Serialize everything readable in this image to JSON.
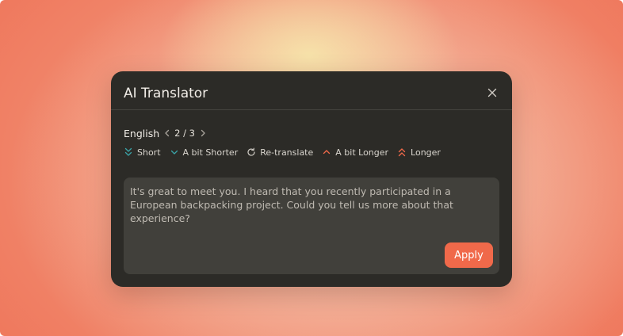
{
  "dialog": {
    "title": "AI Translator",
    "close_icon": "close-icon"
  },
  "language": {
    "name": "English",
    "prev_icon": "chevron-left-icon",
    "pager": "2 / 3",
    "next_icon": "chevron-right-icon"
  },
  "options": [
    {
      "label": "Short",
      "icon": "double-chevron-down-icon",
      "color": "#3aa3a6"
    },
    {
      "label": "A bit Shorter",
      "icon": "chevron-down-icon",
      "color": "#3aa3a6"
    },
    {
      "label": "Re-translate",
      "icon": "refresh-icon",
      "color": "#cfcbc4"
    },
    {
      "label": "A bit Longer",
      "icon": "chevron-up-icon",
      "color": "#f0694a"
    },
    {
      "label": "Longer",
      "icon": "double-chevron-up-icon",
      "color": "#f0694a"
    }
  ],
  "translation": {
    "text": "It's great to meet you. I heard that you recently participated in a European backpacking project. Could you tell us more about that experience?"
  },
  "apply_label": "Apply",
  "colors": {
    "background": "#ee6d52",
    "dialog": "#2c2b27",
    "text_area": "#41403b",
    "accent": "#f0694a",
    "teal": "#3aa3a6"
  }
}
